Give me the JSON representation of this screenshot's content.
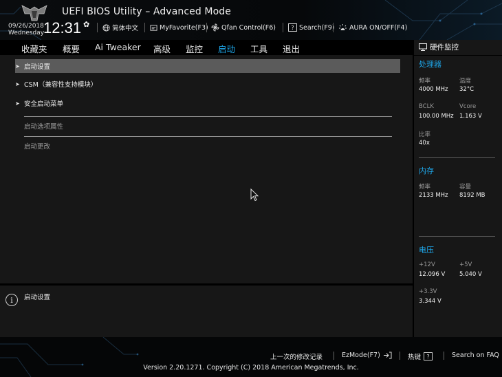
{
  "header": {
    "title": "UEFI BIOS Utility – Advanced Mode",
    "date": "09/26/2018",
    "weekday": "Wednesday",
    "time": "12:31",
    "items": {
      "language": "简体中文",
      "myfavorite": "MyFavorite(F3)",
      "qfan": "Qfan Control(F6)",
      "search": "Search(F9)",
      "aura": "AURA ON/OFF(F4)"
    }
  },
  "menu": {
    "favorites": "收藏夹",
    "main": "概要",
    "ai_tweaker": "Ai Tweaker",
    "advanced": "高级",
    "monitor": "监控",
    "boot": "启动",
    "tool": "工具",
    "exit": "退出",
    "active": "boot"
  },
  "main": {
    "items": [
      {
        "label": "启动设置",
        "selected": true
      },
      {
        "label": "CSM（兼容性支持模块）",
        "selected": false
      },
      {
        "label": "安全启动菜单",
        "selected": false
      }
    ],
    "section_boot_option": "启动选项属性",
    "section_boot_override": "启动更改"
  },
  "help": {
    "text": "启动设置"
  },
  "monitor": {
    "title": "硬件监控",
    "cpu": {
      "heading": "处理器",
      "freq_label": "频率",
      "freq_value": "4000 MHz",
      "temp_label": "温度",
      "temp_value": "32°C",
      "bclk_label": "BCLK",
      "bclk_value": "100.00 MHz",
      "vcore_label": "Vcore",
      "vcore_value": "1.163 V",
      "ratio_label": "比率",
      "ratio_value": "40x"
    },
    "memory": {
      "heading": "内存",
      "freq_label": "频率",
      "freq_value": "2133 MHz",
      "cap_label": "容量",
      "cap_value": "8192 MB"
    },
    "voltage": {
      "heading": "电压",
      "v12_label": "+12V",
      "v12_value": "12.096 V",
      "v5_label": "+5V",
      "v5_value": "5.040 V",
      "v33_label": "+3.3V",
      "v33_value": "3.344 V"
    }
  },
  "footer": {
    "last_modified": "上一次的修改记录",
    "ezmode": "EzMode(F7)",
    "hotkeys": "热键",
    "hotkeys_key": "?",
    "faq": "Search on FAQ",
    "version": "Version 2.20.1271. Copyright (C) 2018 American Megatrends, Inc."
  },
  "colors": {
    "accent": "#1ea7ea",
    "panel": "#171717",
    "selected_row": "#5b5b5b"
  }
}
